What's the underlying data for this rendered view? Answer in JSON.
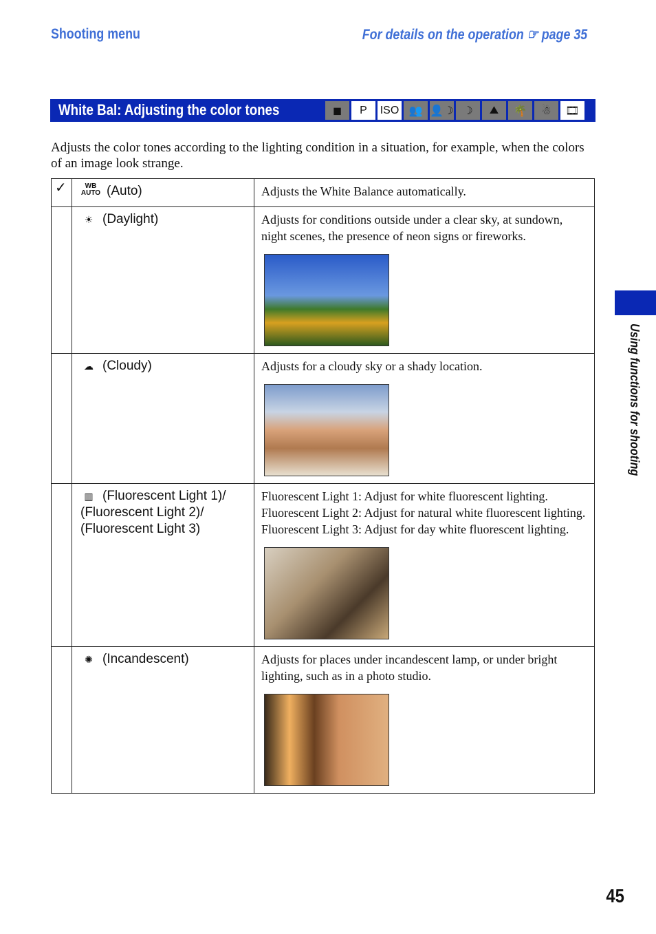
{
  "header": {
    "section": "Shooting menu",
    "reference": "For details on the operation ☞ page 35"
  },
  "title_bar": {
    "title": "White Bal: Adjusting the color tones",
    "modes": [
      {
        "icon": "camera-auto-icon",
        "label": "◼",
        "enabled": false
      },
      {
        "icon": "program-icon",
        "label": "P",
        "enabled": true
      },
      {
        "icon": "high-sensitivity-iso-icon",
        "label": "ISO",
        "enabled": true
      },
      {
        "icon": "soft-snap-icon",
        "label": "👥",
        "enabled": false
      },
      {
        "icon": "twilight-portrait-icon",
        "label": "👤☽",
        "enabled": false
      },
      {
        "icon": "twilight-icon",
        "label": "☽",
        "enabled": false
      },
      {
        "icon": "landscape-icon",
        "label": "⛰",
        "enabled": false
      },
      {
        "icon": "beach-icon",
        "label": "🌴",
        "enabled": false
      },
      {
        "icon": "snow-icon",
        "label": "☃",
        "enabled": false
      },
      {
        "icon": "movie-icon",
        "label": "🎞",
        "enabled": true
      }
    ]
  },
  "intro": "Adjusts the color tones according to the lighting condition in a situation, for example, when the colors of an image look strange.",
  "rows": [
    {
      "default": true,
      "icon": "wb-auto-icon",
      "glyph": "WB AUTO",
      "label": "(Auto)",
      "desc": "Adjusts the White Balance automatically.",
      "photo": null
    },
    {
      "default": false,
      "icon": "daylight-icon",
      "glyph": "☀",
      "label": "(Daylight)",
      "desc": "Adjusts for conditions outside under a clear sky, at sundown, night scenes, the presence of neon signs or fireworks.",
      "photo": "sunflowers"
    },
    {
      "default": false,
      "icon": "cloudy-icon",
      "glyph": "☁",
      "label": "(Cloudy)",
      "desc": "Adjusts for a cloudy sky or a shady location.",
      "photo": "beach-building"
    },
    {
      "default": false,
      "icon": "fluorescent-icon",
      "glyph": "▥",
      "label": "(Fluorescent Light 1)/\n(Fluorescent Light 2)/\n(Fluorescent Light 3)",
      "desc": "Fluorescent Light 1: Adjust for white fluorescent lighting.\nFluorescent Light 2: Adjust for natural white fluorescent lighting.\nFluorescent Light 3: Adjust for day white fluorescent lighting.",
      "photo": "people-cheering"
    },
    {
      "default": false,
      "icon": "incandescent-icon",
      "glyph": "✺",
      "label": "(Incandescent)",
      "desc": "Adjusts for places under incandescent lamp, or under bright lighting, such as in a photo studio.",
      "photo": "woman-lamp"
    }
  ],
  "side_tab": "Using functions for shooting",
  "page_number": "45",
  "colors": {
    "accent": "#0a28b4",
    "header_text": "#3f6fd6"
  }
}
